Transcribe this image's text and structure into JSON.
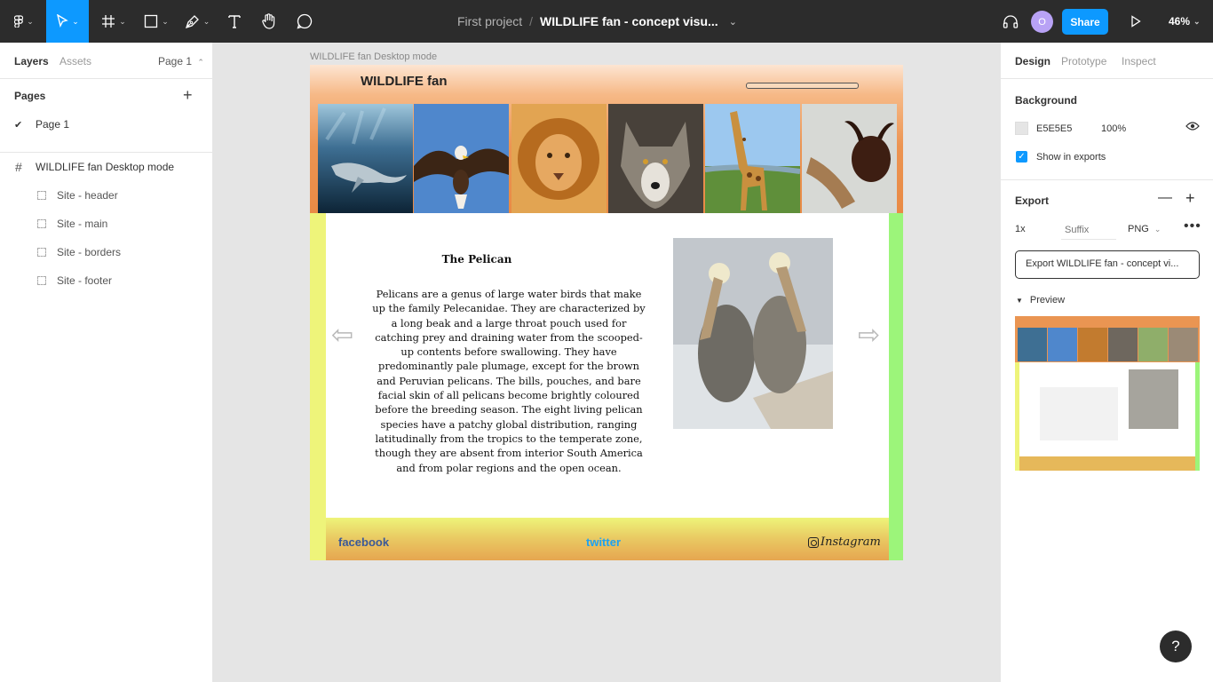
{
  "toolbar": {
    "project": "First project",
    "separator": "/",
    "file_title": "WILDLIFE fan - concept visu...",
    "share_label": "Share",
    "avatar_initial": "O",
    "zoom": "46%"
  },
  "left_panel": {
    "tabs": [
      "Layers",
      "Assets"
    ],
    "page_select": "Page 1",
    "pages_label": "Pages",
    "pages": [
      "Page 1"
    ],
    "frame_name": "WILDLIFE fan Desktop mode",
    "layers": [
      "Site - header",
      "Site - main",
      "Site - borders",
      "Site - footer"
    ]
  },
  "canvas": {
    "frame_label": "WILDLIFE fan Desktop mode",
    "logo": "WILDLIFE fan",
    "animals": [
      "whale",
      "eagle",
      "lion",
      "wolf",
      "giraffe",
      "beetle"
    ],
    "article_title": "The Pelican",
    "article_body": "Pelicans are a genus of large water birds that make up the family Pelecanidae. They are characterized by a long beak and a large throat pouch used for catching prey and draining water from the scooped-up contents before swallowing. They have predominantly pale plumage, except for the brown and Peruvian pelicans. The bills, pouches, and bare facial skin of all pelicans become brightly coloured before the breeding season. The eight living pelican species have a patchy global distribution, ranging latitudinally from the tropics to the temperate zone, though they are absent from interior South America and from polar regions and the open ocean.",
    "arrow_left": "⇦",
    "arrow_right": "⇨",
    "footer": {
      "facebook": "facebook",
      "twitter": "twitter",
      "instagram": "Instagram"
    }
  },
  "right_panel": {
    "tabs": [
      "Design",
      "Prototype",
      "Inspect"
    ],
    "background_label": "Background",
    "bg_hex": "E5E5E5",
    "bg_opacity": "100%",
    "show_in_exports": "Show in exports",
    "export_label": "Export",
    "export_scale": "1x",
    "export_suffix_placeholder": "Suffix",
    "export_format": "PNG",
    "export_button": "Export WILDLIFE fan - concept vi...",
    "preview_label": "Preview"
  },
  "help_label": "?",
  "colors": {
    "accent": "#0d99ff",
    "toolbar_bg": "#2c2c2c",
    "canvas_bg": "#e5e5e5"
  }
}
